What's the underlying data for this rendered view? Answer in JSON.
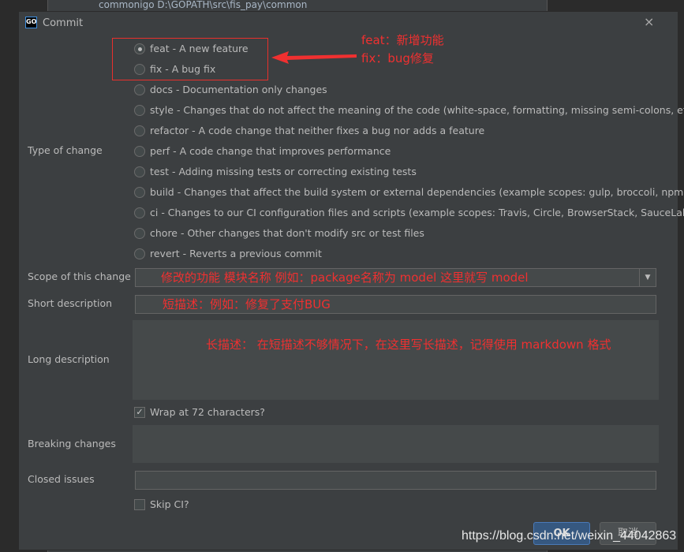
{
  "background": {
    "rows": [
      "commonigo D:\\GOPATH\\src\\fis_pay\\common"
    ]
  },
  "dialog": {
    "title": "Commit",
    "close": "×",
    "logo": "GO"
  },
  "type_of_change": {
    "label": "Type of change",
    "selected": 0,
    "options": [
      "feat - A new feature",
      "fix - A bug fix",
      "docs - Documentation only changes",
      "style - Changes that do not affect the meaning of the code (white-space, formatting, missing semi-colons, etc)",
      "refactor - A code change that neither fixes a bug nor adds a feature",
      "perf - A code change that improves performance",
      "test - Adding missing tests or correcting existing tests",
      "build - Changes that affect the build system or external dependencies (example scopes: gulp, broccoli, npm)",
      "ci - Changes to our CI configuration files and scripts (example scopes: Travis, Circle, BrowserStack, SauceLabs)",
      "chore - Other changes that don't modify src or test files",
      "revert - Reverts a previous commit"
    ]
  },
  "annotations": {
    "feat": "feat：新增功能",
    "fix": "fix：bug修复",
    "scope": "修改的功能 模块名称 例如：package名称为 model   这里就写 model",
    "short": "短描述：例如：修复了支付BUG",
    "long": "长描述：  在短描述不够情况下，在这里写长描述，记得使用 markdown 格式"
  },
  "fields": {
    "scope_label": "Scope of this change",
    "short_label": "Short description",
    "long_label": "Long description",
    "wrap_label": "Wrap at 72 characters?",
    "wrap_checked": true,
    "breaking_label": "Breaking changes",
    "closed_label": "Closed issues",
    "skip_ci_label": "Skip CI?",
    "skip_ci_checked": false
  },
  "buttons": {
    "ok": "OK",
    "cancel": "取消"
  },
  "watermark": "https://blog.csdn.net/weixin_44042863",
  "colors": {
    "accent": "#365880",
    "annotation": "#f03030"
  }
}
